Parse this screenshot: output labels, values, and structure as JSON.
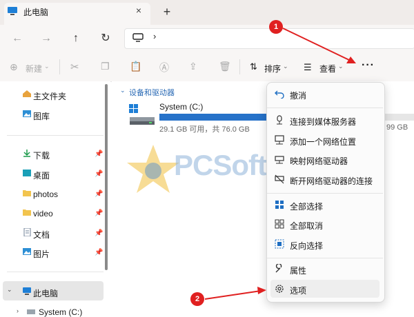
{
  "window": {
    "tab_title": "此电脑",
    "tab_close": "×",
    "new_tab": "+"
  },
  "address": {
    "chevron": "›"
  },
  "toolbar": {
    "new_label": "新建",
    "sort_label": "排序",
    "view_label": "查看",
    "more": "···"
  },
  "sidebar": {
    "items": [
      {
        "label": "主文件夹",
        "icon": "home-icon"
      },
      {
        "label": "图库",
        "icon": "gallery-icon"
      },
      {
        "label": "下载",
        "icon": "download-icon",
        "pinned": true
      },
      {
        "label": "桌面",
        "icon": "desktop-icon",
        "pinned": true
      },
      {
        "label": "photos",
        "icon": "folder-icon",
        "pinned": true
      },
      {
        "label": "video",
        "icon": "folder-icon",
        "pinned": true
      },
      {
        "label": "文档",
        "icon": "document-icon",
        "pinned": true
      },
      {
        "label": "图片",
        "icon": "picture-icon",
        "pinned": true
      },
      {
        "label": "此电脑",
        "icon": "computer-icon"
      },
      {
        "label": "System (C:)",
        "icon": "drive-icon"
      }
    ]
  },
  "content": {
    "group_header": "设备和驱动器",
    "drive": {
      "name": "System (C:)",
      "free_text": "29.1 GB 可用，共 76.0 GB",
      "used_fraction": 0.617,
      "right_text": "99 GB"
    }
  },
  "watermark": {
    "text": "PCSofter"
  },
  "menu": {
    "items": [
      {
        "label": "撤消",
        "icon": "undo-icon"
      },
      {
        "label": "连接到媒体服务器",
        "icon": "media-server-icon"
      },
      {
        "label": "添加一个网络位置",
        "icon": "network-location-icon"
      },
      {
        "label": "映射网络驱动器",
        "icon": "map-drive-icon"
      },
      {
        "label": "断开网络驱动器的连接",
        "icon": "disconnect-drive-icon"
      },
      {
        "label": "全部选择",
        "icon": "select-all-icon"
      },
      {
        "label": "全部取消",
        "icon": "select-none-icon"
      },
      {
        "label": "反向选择",
        "icon": "invert-selection-icon"
      },
      {
        "label": "属性",
        "icon": "properties-icon"
      },
      {
        "label": "选项",
        "icon": "options-icon"
      }
    ]
  },
  "annotations": {
    "badge_1": "1",
    "badge_2": "2"
  },
  "colors": {
    "accent": "#2672c9",
    "arrow": "#e02020"
  }
}
